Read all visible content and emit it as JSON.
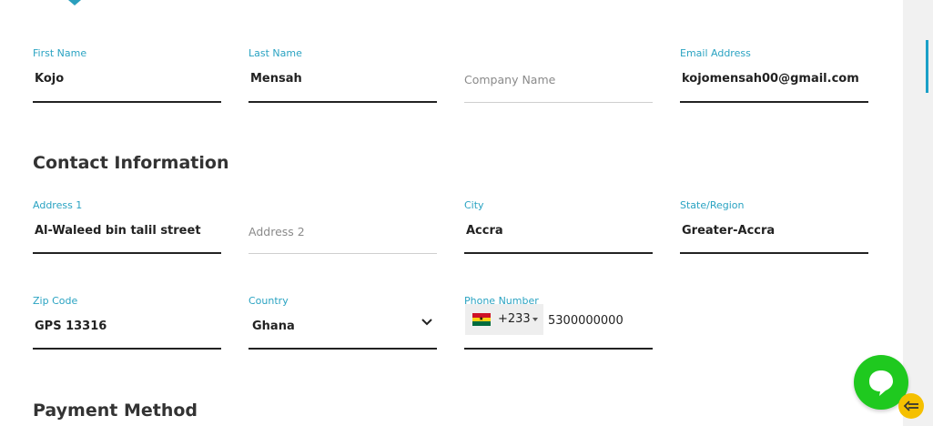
{
  "colors": {
    "accent": "#2aa3c2",
    "chat_button": "#1fc91f",
    "collapse_button": "#f5c000",
    "scroll_thumb": "#1aa0c8"
  },
  "personal": {
    "first_name": {
      "label": "First Name",
      "value": "Kojo"
    },
    "last_name": {
      "label": "Last Name",
      "value": "Mensah"
    },
    "company": {
      "placeholder": "Company Name"
    },
    "email": {
      "label": "Email Address",
      "value": "kojomensah00@gmail.com"
    }
  },
  "contact": {
    "heading": "Contact Information",
    "address1": {
      "label": "Address 1",
      "value": "Al-Waleed bin talil street"
    },
    "address2": {
      "placeholder": "Address 2"
    },
    "city": {
      "label": "City",
      "value": "Accra"
    },
    "state": {
      "label": "State/Region",
      "value": "Greater-Accra"
    },
    "zip": {
      "label": "Zip Code",
      "value": "GPS 13316"
    },
    "country": {
      "label": "Country",
      "value": "Ghana"
    },
    "phone": {
      "label": "Phone Number",
      "flag": "ghana-flag-icon",
      "dial_code": "+233",
      "number": "5300000000"
    }
  },
  "payment": {
    "heading": "Payment Method"
  },
  "icons": {
    "chat": "chat-bubble-icon",
    "collapse": "collapse-arrow-icon",
    "dropdown": "chevron-down-icon"
  }
}
